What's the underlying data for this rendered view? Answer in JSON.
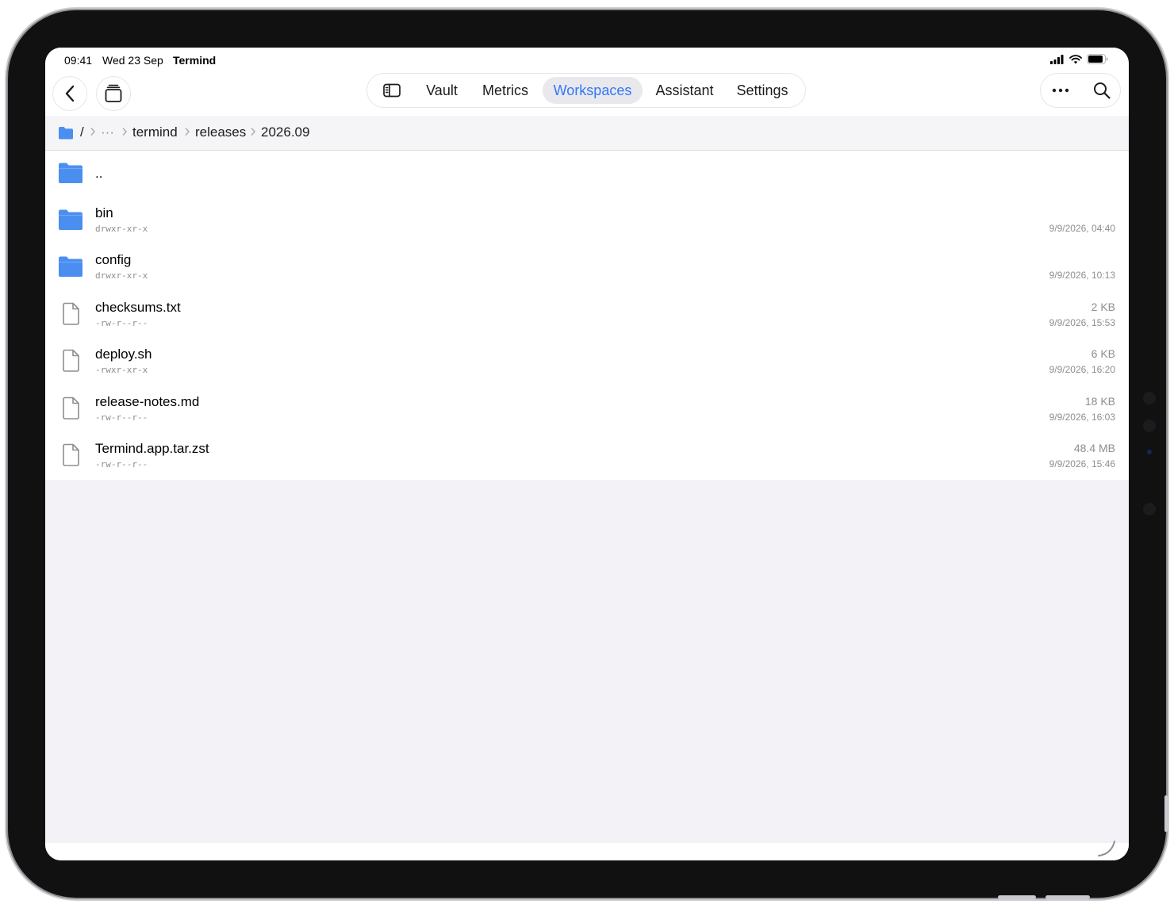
{
  "status_bar": {
    "time": "09:41",
    "date": "Wed 23 Sep",
    "app_name": "Termind"
  },
  "toolbar": {
    "back_icon": "chevron-left-icon",
    "windows_icon": "stacked-windows-icon",
    "sidebar_icon": "sidebar-toggle-icon",
    "tabs": [
      {
        "label": "Vault",
        "active": false
      },
      {
        "label": "Metrics",
        "active": false
      },
      {
        "label": "Workspaces",
        "active": true
      },
      {
        "label": "Assistant",
        "active": false
      },
      {
        "label": "Settings",
        "active": false
      }
    ],
    "more_icon": "ellipsis-icon",
    "search_icon": "search-icon"
  },
  "breadcrumb": {
    "root": "/",
    "overflow": "···",
    "segments": [
      "termind",
      "releases",
      "2026.09"
    ]
  },
  "files": [
    {
      "name": "..",
      "type": "folder",
      "permissions": "",
      "size": "",
      "modified": ""
    },
    {
      "name": "bin",
      "type": "folder",
      "permissions": "drwxr-xr-x",
      "size": "",
      "modified": "9/9/2026, 04:40"
    },
    {
      "name": "config",
      "type": "folder",
      "permissions": "drwxr-xr-x",
      "size": "",
      "modified": "9/9/2026, 10:13"
    },
    {
      "name": "checksums.txt",
      "type": "file",
      "permissions": "-rw-r--r--",
      "size": "2 KB",
      "modified": "9/9/2026, 15:53"
    },
    {
      "name": "deploy.sh",
      "type": "file",
      "permissions": "-rwxr-xr-x",
      "size": "6 KB",
      "modified": "9/9/2026, 16:20"
    },
    {
      "name": "release-notes.md",
      "type": "file",
      "permissions": "-rw-r--r--",
      "size": "18 KB",
      "modified": "9/9/2026, 16:03"
    },
    {
      "name": "Termind.app.tar.zst",
      "type": "file",
      "permissions": "-rw-r--r--",
      "size": "48.4 MB",
      "modified": "9/9/2026, 15:46"
    }
  ],
  "colors": {
    "accent": "#3478f6",
    "folder": "#4a8ef0",
    "secondary_text": "#8e8e93",
    "background": "#f2f2f7"
  }
}
